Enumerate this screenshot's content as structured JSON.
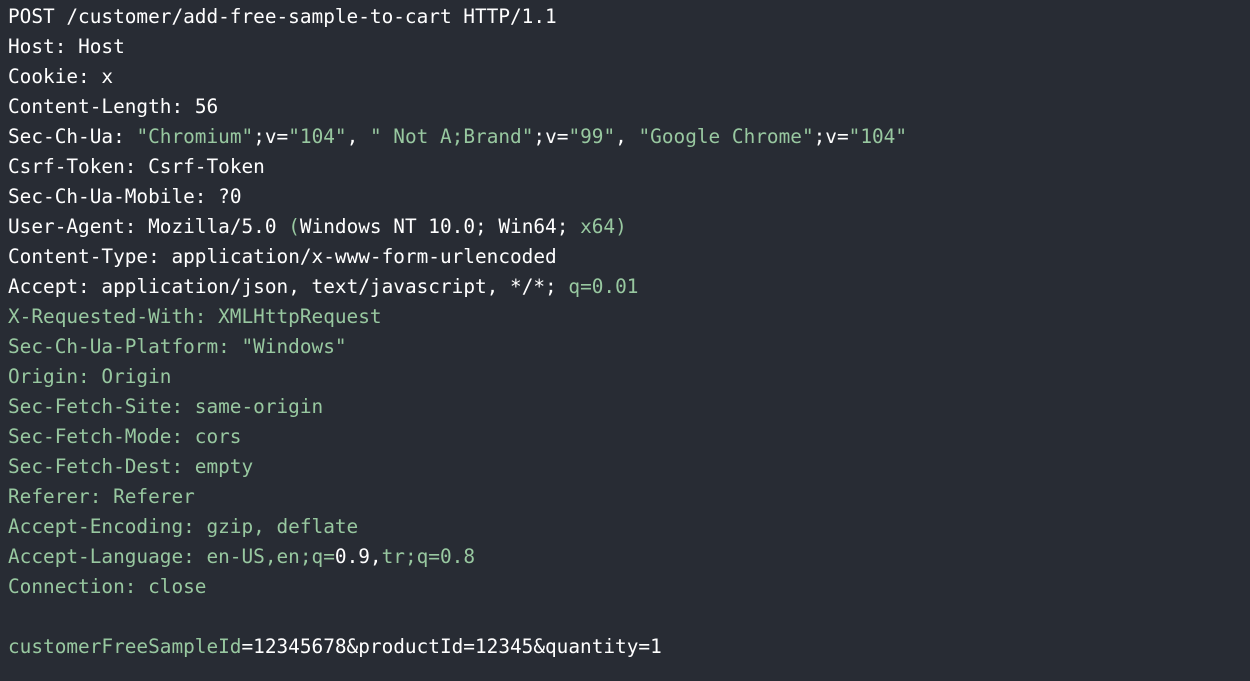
{
  "colors": {
    "background": "#282c34",
    "text": "#ffffff",
    "muted_green": "#98c8a0"
  },
  "request": {
    "request_line": "POST /customer/add-free-sample-to-cart HTTP/1.1",
    "host_label": "Host:",
    "host_value": "Host",
    "cookie_label": "Cookie:",
    "cookie_value": "x",
    "content_length_label": "Content-Length:",
    "content_length_value": "56",
    "sec_ch_ua_label": "Sec-Ch-Ua:",
    "sec_ch_ua_p1": "\"Chromium\"",
    "sec_ch_ua_p2": ";v=",
    "sec_ch_ua_p3": "\"104\"",
    "sec_ch_ua_p4": ", ",
    "sec_ch_ua_p5": "\" Not A;Brand\"",
    "sec_ch_ua_p6": ";v=",
    "sec_ch_ua_p7": "\"99\"",
    "sec_ch_ua_p8": ", ",
    "sec_ch_ua_p9": "\"Google Chrome\"",
    "sec_ch_ua_p10": ";v=",
    "sec_ch_ua_p11": "\"104\"",
    "csrf_label": "Csrf-Token:",
    "csrf_value": "Csrf-Token",
    "mobile_label": "Sec-Ch-Ua-Mobile:",
    "mobile_value": "?0",
    "ua_label": "User-Agent:",
    "ua_p1": "Mozilla/5.0 ",
    "ua_p2": "(",
    "ua_p3": "Windows NT 10.0; Win64; ",
    "ua_p4": "x64)",
    "content_type_label": "Content-Type:",
    "content_type_value": "application/x-www-form-urlencoded",
    "accept_label": "Accept:",
    "accept_value": "application/json, text/javascript, */*; ",
    "accept_q": "q=0.01",
    "xrw": "X-Requested-With: XMLHttpRequest",
    "platform": "Sec-Ch-Ua-Platform: \"Windows\"",
    "origin": "Origin: Origin",
    "fetch_site": "Sec-Fetch-Site: same-origin",
    "fetch_mode": "Sec-Fetch-Mode: cors",
    "fetch_dest": "Sec-Fetch-Dest: empty",
    "referer": "Referer: Referer",
    "accept_encoding": "Accept-Encoding: gzip, deflate",
    "al_p1": "Accept-Language: en-US,en;q=",
    "al_p2": "0.9,",
    "al_p3": "tr;q=0.8",
    "connection": "Connection: close",
    "body_p1": "customerFreeSampleId",
    "body_p2": "=12345678&productId=12345&quantity=1"
  }
}
